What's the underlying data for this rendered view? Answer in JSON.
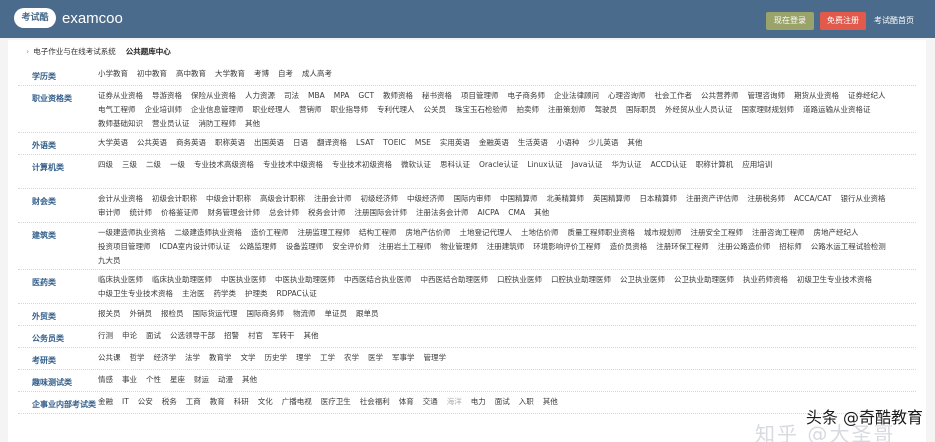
{
  "header": {
    "logo_badge": "考试酷",
    "logo_text": "examcoo",
    "login": "现在登录",
    "register": "免费注册",
    "home": "考试酷首页"
  },
  "breadcrumb": {
    "parent": "电子作业与在线考试系统",
    "current": "公共题库中心"
  },
  "categories": [
    {
      "label": "学历类",
      "items": [
        "小学教育",
        "初中教育",
        "高中教育",
        "大学教育",
        "考博",
        "自考",
        "成人高考"
      ]
    },
    {
      "label": "职业资格类",
      "items": [
        "证券从业资格",
        "导游资格",
        "保险从业资格",
        "人力资源",
        "司法",
        "MBA",
        "MPA",
        "GCT",
        "教师资格",
        "秘书资格",
        "项目管理师",
        "电子商务师",
        "企业法律顾问",
        "心理咨询师",
        "社会工作者",
        "公共营养师",
        "管理咨询师",
        "期货从业资格",
        "证券经纪人",
        "电气工程师",
        "企业培训师",
        "企业信息管理师",
        "职业经理人",
        "营销师",
        "职业指导师",
        "专利代理人",
        "公关员",
        "珠宝玉石检验师",
        "拍卖师",
        "注册策划师",
        "驾驶员",
        "国际职员",
        "外经贸从业人员认证",
        "国家理财规划师",
        "道路运输从业资格证",
        "教师基础知识",
        "营业员认证",
        "消防工程师",
        "其他"
      ]
    },
    {
      "label": "外语类",
      "items": [
        "大学英语",
        "公共英语",
        "商务英语",
        "职称英语",
        "出国英语",
        "日语",
        "翻译资格",
        "LSAT",
        "TOEIC",
        "MSE",
        "实用英语",
        "金融英语",
        "生活英语",
        "小语种",
        "少儿英语",
        "其他"
      ]
    },
    {
      "label": "计算机类",
      "items": [
        "四级",
        "三级",
        "二级",
        "一级",
        "专业技术高级资格",
        "专业技术中级资格",
        "专业技术初级资格",
        "微软认证",
        "思科认证",
        "Oracle认证",
        "Linux认证",
        "Java认证",
        "华为认证",
        "ACCD认证",
        "职称计算机",
        "应用培训"
      ]
    },
    {
      "label": "财会类",
      "items": [
        "会计从业资格",
        "初级会计职称",
        "中级会计职称",
        "高级会计职称",
        "注册会计师",
        "初级经济师",
        "中级经济师",
        "国际内审师",
        "中国精算师",
        "北美精算师",
        "英国精算师",
        "日本精算师",
        "注册资产评估师",
        "注册税务师",
        "ACCA/CAT",
        "银行从业资格",
        "审计师",
        "统计师",
        "价格鉴证师",
        "财务管理会计师",
        "总会计师",
        "税务会计师",
        "注册国际会计师",
        "注册法务会计师",
        "AICPA",
        "CMA",
        "其他"
      ]
    },
    {
      "label": "建筑类",
      "items": [
        "一级建造师执业资格",
        "二级建造师执业资格",
        "造价工程师",
        "注册监理工程师",
        "结构工程师",
        "房地产估价师",
        "土地登记代理人",
        "土地估价师",
        "质量工程师职业资格",
        "城市规划师",
        "注册安全工程师",
        "注册咨询工程师",
        "房地产经纪人",
        "投资项目管理师",
        "ICDA室内设计师认证",
        "公路监理师",
        "设备监理师",
        "安全评价师",
        "注册岩土工程师",
        "物业管理师",
        "注册建筑师",
        "环境影响评价工程师",
        "造价员资格",
        "注册环保工程师",
        "注册公路造价师",
        "招标师",
        "公路水运工程试验检测",
        "九大员"
      ]
    },
    {
      "label": "医药类",
      "items": [
        "临床执业医师",
        "临床执业助理医师",
        "中医执业医师",
        "中医执业助理医师",
        "中西医结合执业医师",
        "中西医结合助理医师",
        "口腔执业医师",
        "口腔执业助理医师",
        "公卫执业医师",
        "公卫执业助理医师",
        "执业药师资格",
        "初级卫生专业技术资格",
        "中级卫生专业技术资格",
        "主治医",
        "药学类",
        "护理类",
        "RDPAC认证"
      ]
    },
    {
      "label": "外贸类",
      "items": [
        "报关员",
        "外销员",
        "报检员",
        "国际货运代理",
        "国际商务师",
        "物流师",
        "单证员",
        "跟单员"
      ]
    },
    {
      "label": "公务员类",
      "items": [
        "行测",
        "申论",
        "面试",
        "公选领导干部",
        "招警",
        "村官",
        "军转干",
        "其他"
      ]
    },
    {
      "label": "考研类",
      "items": [
        "公共课",
        "哲学",
        "经济学",
        "法学",
        "教育学",
        "文学",
        "历史学",
        "理学",
        "工学",
        "农学",
        "医学",
        "军事学",
        "管理学"
      ]
    },
    {
      "label": "趣味测试类",
      "items": [
        "情感",
        "事业",
        "个性",
        "星座",
        "财运",
        "动漫",
        "其他"
      ]
    },
    {
      "label": "企事业内部考试类",
      "items": [
        "金融",
        "IT",
        "公安",
        "税务",
        "工商",
        "教育",
        "科研",
        "文化",
        "广播电视",
        "医疗卫生",
        "社会福利",
        "体育",
        "交通",
        "海洋",
        "电力",
        "面试",
        "入职",
        "其他"
      ]
    }
  ],
  "watermark_bg": "知乎 @大圣哥",
  "watermark": "头条 @奇酷教育"
}
